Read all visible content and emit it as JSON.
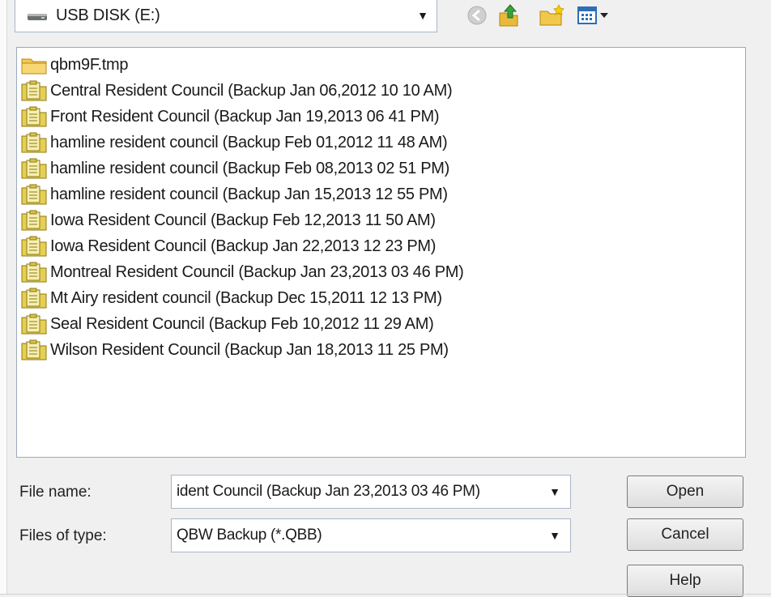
{
  "look_in": {
    "label": "USB DISK (E:)",
    "icon": "drive-icon"
  },
  "toolbar": {
    "back_icon": "back-arrow-icon",
    "up_icon": "up-folder-icon",
    "new_folder_icon": "new-folder-icon",
    "view_icon": "view-menu-icon"
  },
  "files": [
    {
      "name": "qbm9F.tmp",
      "type": "folder"
    },
    {
      "name": "Central Resident Council (Backup Jan 06,2012  10 10 AM)",
      "type": "backup"
    },
    {
      "name": "Front Resident Council (Backup Jan 19,2013  06 41 PM)",
      "type": "backup"
    },
    {
      "name": "hamline resident council (Backup Feb 01,2012  11 48 AM)",
      "type": "backup"
    },
    {
      "name": "hamline resident council (Backup Feb 08,2013  02 51 PM)",
      "type": "backup"
    },
    {
      "name": "hamline resident council (Backup Jan 15,2013  12 55 PM)",
      "type": "backup"
    },
    {
      "name": "Iowa Resident Council (Backup Feb 12,2013  11 50 AM)",
      "type": "backup"
    },
    {
      "name": "Iowa Resident Council (Backup Jan 22,2013  12 23 PM)",
      "type": "backup"
    },
    {
      "name": "Montreal Resident Council (Backup Jan 23,2013  03 46 PM)",
      "type": "backup"
    },
    {
      "name": "Mt Airy resident council (Backup Dec 15,2011  12 13 PM)",
      "type": "backup"
    },
    {
      "name": "Seal Resident Council (Backup Feb 10,2012  11 29 AM)",
      "type": "backup"
    },
    {
      "name": "Wilson Resident Council (Backup Jan 18,2013  11 25 PM)",
      "type": "backup"
    }
  ],
  "file_name": {
    "label": "File name:",
    "value": "ident Council (Backup Jan 23,2013  03 46 PM)"
  },
  "file_type": {
    "label": "Files of type:",
    "value": "QBW Backup (*.QBB)"
  },
  "buttons": {
    "open": "Open",
    "cancel": "Cancel",
    "help": "Help"
  }
}
